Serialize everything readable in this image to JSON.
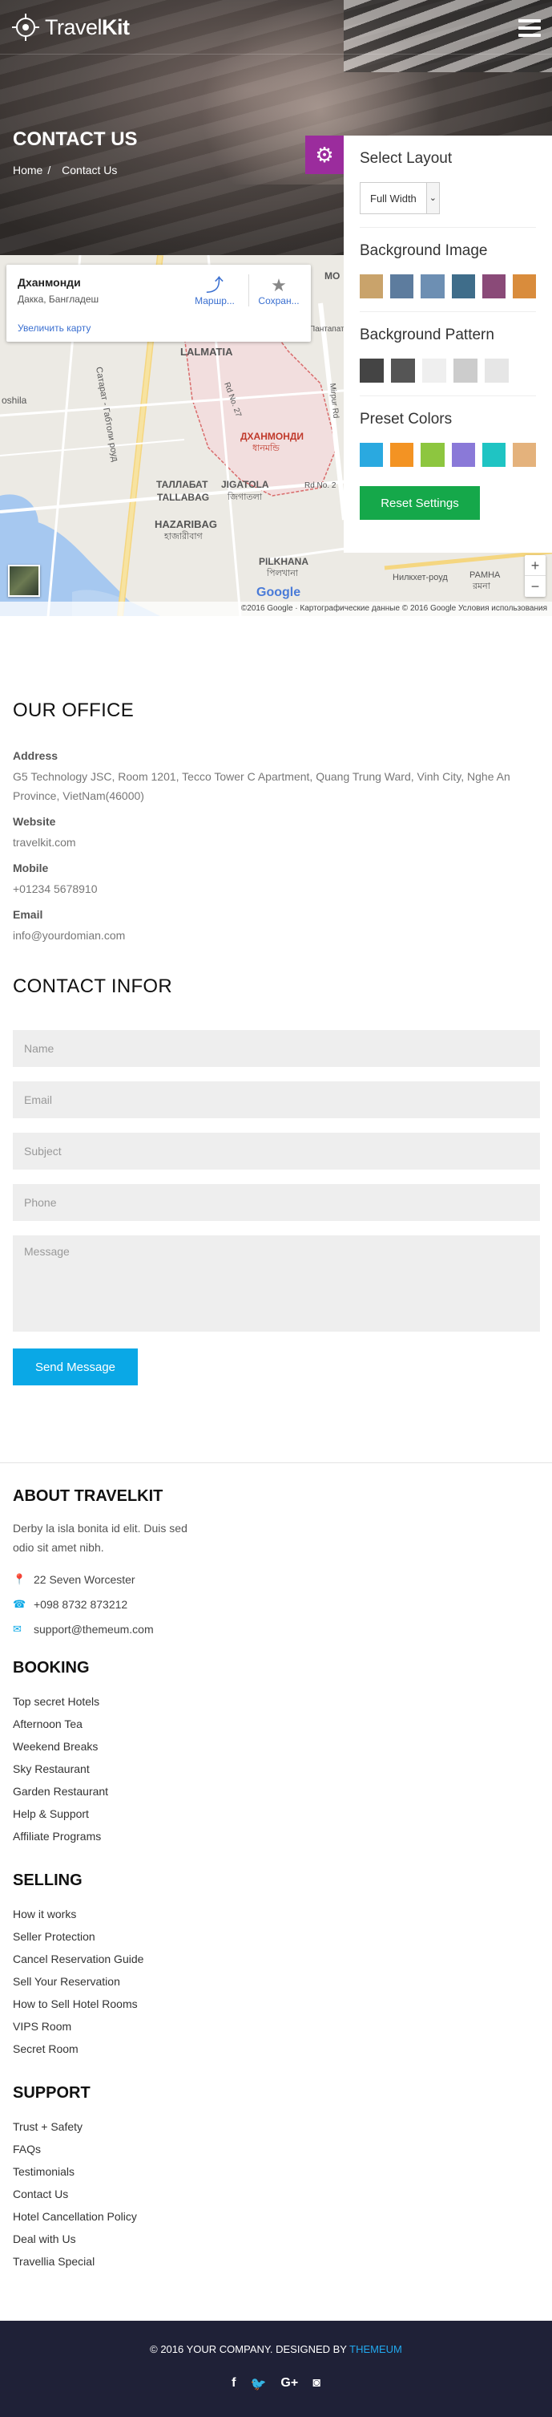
{
  "header": {
    "logo_light": "Travel",
    "logo_bold": "Kit",
    "title": "CONTACT US",
    "breadcrumb": [
      {
        "label": "Home"
      },
      {
        "label": "Contact Us"
      }
    ],
    "icons": {
      "logo": "compass-logo-icon",
      "menu": "hamburger-menu-icon"
    }
  },
  "map": {
    "place": "Дханмонди",
    "region": "Дакка, Бангладеш",
    "enlarge": "Увеличить карту",
    "route": "Маршр...",
    "save": "Сохран...",
    "labels": {
      "lalmatia": "LALMATIA",
      "dhanmondi": "ДХАНМОНДИ",
      "dhanmondi_bn": "ধানমন্ডি",
      "tallabat": "ТАЛЛАБАТ",
      "tallabag": "TALLABAG",
      "jigatola": "JIGATOLA",
      "jigatola_bn": "জিগাতলা",
      "hazaribag": "HAZARIBAG",
      "hazaribag_bn": "হাজারীবাগ",
      "pilkhana": "PILKHANA",
      "pilkhana_bn": "পিলখানা",
      "ramna": "РАМНА",
      "ramna_bn": "রমনা",
      "mo": "MO",
      "oshila": "oshila",
      "gabtoli": "Сатарат - Габтоли роуд",
      "mirpur": "Mirpur Rd",
      "road27": "Rd No. 27",
      "road2": "Rd No. 2",
      "nilkhet": "Нилкхет-роуд",
      "pantapath": "Пантапат"
    },
    "google": "Google",
    "attribution": "©2016 Google · Картографические данные © 2016 Google    Условия использования",
    "zoom_in": "+",
    "zoom_out": "−"
  },
  "settings": {
    "gear_icon": "gear-icon",
    "layout": {
      "title": "Select Layout",
      "value": "Full Width"
    },
    "bg_image": {
      "title": "Background Image",
      "colors": [
        "#c9a36b",
        "#5d7c9e",
        "#6d8fb3",
        "#3f6d8a",
        "#8a4a78",
        "#d98c3c"
      ]
    },
    "bg_pattern": {
      "title": "Background Pattern",
      "colors": [
        "#444444",
        "#555555",
        "#efefef",
        "#cccccc",
        "#e6e6e6"
      ]
    },
    "preset": {
      "title": "Preset Colors",
      "colors": [
        "#2aa9e0",
        "#f39323",
        "#8dc63f",
        "#8a79d8",
        "#1fc4c3",
        "#e4b27c"
      ]
    },
    "reset_label": "Reset Settings"
  },
  "office": {
    "title": "OUR OFFICE",
    "address_label": "Address",
    "address": "G5 Technology JSC, Room 1201, Tecco Tower C Apartment, Quang Trung Ward, Vinh City, Nghe An Province, VietNam(46000)",
    "website_label": "Website",
    "website": "travelkit.com",
    "mobile_label": "Mobile",
    "mobile": "+01234 5678910",
    "email_label": "Email",
    "email": "info@yourdomian.com"
  },
  "contact_form": {
    "title": "CONTACT INFOR",
    "name_ph": "Name",
    "email_ph": "Email",
    "subject_ph": "Subject",
    "phone_ph": "Phone",
    "message_ph": "Message",
    "send": "Send Message"
  },
  "about": {
    "title": "ABOUT TRAVELKIT",
    "text": "Derby la isla bonita id elit. Duis sed odio sit amet nibh.",
    "address": "22 Seven Worcester",
    "phone": "+098 8732 873212",
    "email": "support@themeum.com",
    "icons": {
      "address": "map-marker-icon",
      "phone": "phone-icon",
      "email": "envelope-icon"
    }
  },
  "booking": {
    "title": "BOOKING",
    "items": [
      "Top secret Hotels",
      "Afternoon Tea",
      "Weekend Breaks",
      "Sky Restaurant",
      "Garden Restaurant",
      "Help & Support",
      "Affiliate Programs"
    ]
  },
  "selling": {
    "title": "SELLING",
    "items": [
      "How it works",
      "Seller Protection",
      "Cancel Reservation Guide",
      "Sell Your Reservation",
      "How to Sell Hotel Rooms",
      "VIPS Room",
      "Secret Room"
    ]
  },
  "support": {
    "title": "SUPPORT",
    "items": [
      "Trust + Safety",
      "FAQs",
      "Testimonials",
      "Contact Us",
      "Hotel Cancellation Policy",
      "Deal with Us",
      "Travellia Special"
    ]
  },
  "footer": {
    "copy": "© 2016 YOUR COMPANY.  DESIGNED BY",
    "designer": "THEMEUM",
    "social": [
      "f",
      "🐦",
      "G+",
      "◙"
    ],
    "social_icons": [
      "facebook-icon",
      "twitter-icon",
      "google-plus-icon",
      "instagram-icon"
    ]
  }
}
